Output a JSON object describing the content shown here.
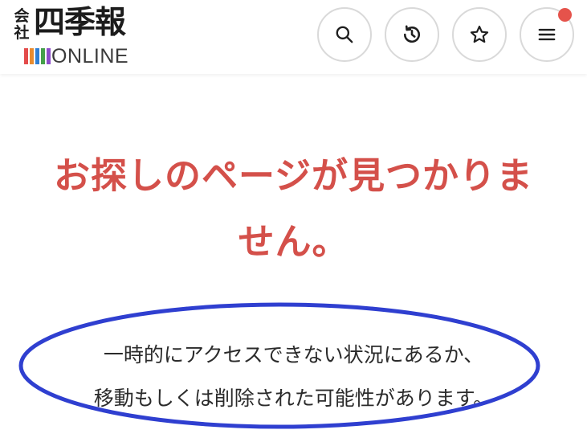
{
  "header": {
    "logo": {
      "small_text": "会社",
      "main_text": "四季報",
      "online_text": "ONLINE"
    },
    "buttons": {
      "search": {
        "icon": "search-icon"
      },
      "history": {
        "icon": "history-icon"
      },
      "favorites": {
        "icon": "star-icon"
      },
      "menu": {
        "icon": "hamburger-menu-icon"
      }
    }
  },
  "error": {
    "title_line1": "お探しのページが見つかりま",
    "title_line2": "せん。",
    "message_line1": "一時的にアクセスできない状況にあるか、",
    "message_line2": "移動もしくは削除された可能性があります。"
  },
  "colors": {
    "title": "#d4504a",
    "badge": "#e5534b",
    "annotation": "#2f3fd0",
    "logo_bars": [
      "#e34b4b",
      "#e88b2e",
      "#2f7fd4",
      "#45a04a",
      "#8c4cc9"
    ]
  }
}
